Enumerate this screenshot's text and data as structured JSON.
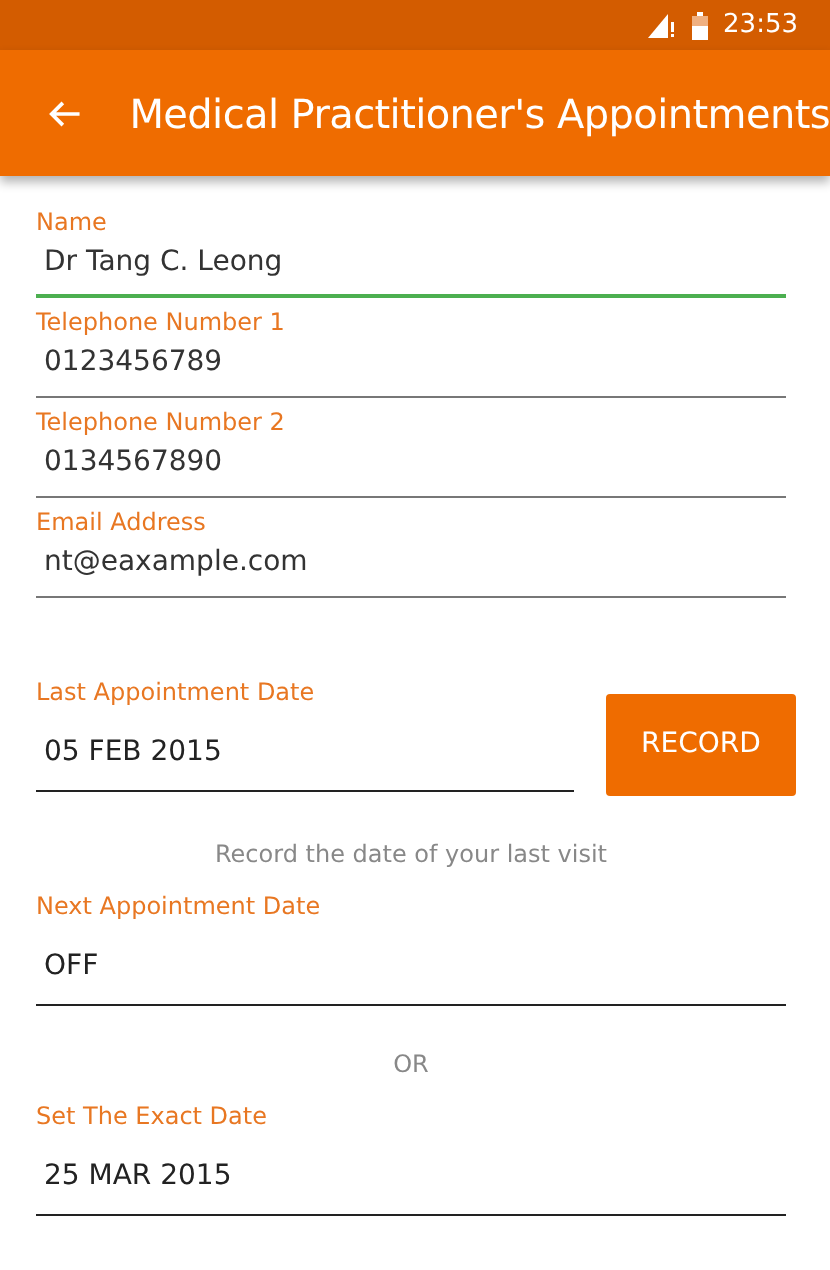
{
  "status_bar": {
    "time": "23:53"
  },
  "app_bar": {
    "title": "Medical Practitioner's Appointments"
  },
  "fields": [
    {
      "label": "Name",
      "value": "Dr Tang C. Leong",
      "focused": true
    },
    {
      "label": "Telephone Number 1",
      "value": "0123456789",
      "focused": false
    },
    {
      "label": "Telephone Number 2",
      "value": "0134567890",
      "focused": false
    },
    {
      "label": "Email Address",
      "value": "nt@eaxample.com",
      "focused": false
    }
  ],
  "last_appointment": {
    "label": "Last Appointment Date",
    "value": "05 FEB 2015",
    "button": "RECORD",
    "hint": "Record the date of your last visit"
  },
  "next_appointment": {
    "label": "Next Appointment Date",
    "value": "OFF"
  },
  "separator": "OR",
  "exact_date": {
    "label": "Set The Exact Date",
    "value": "25 MAR 2015"
  }
}
